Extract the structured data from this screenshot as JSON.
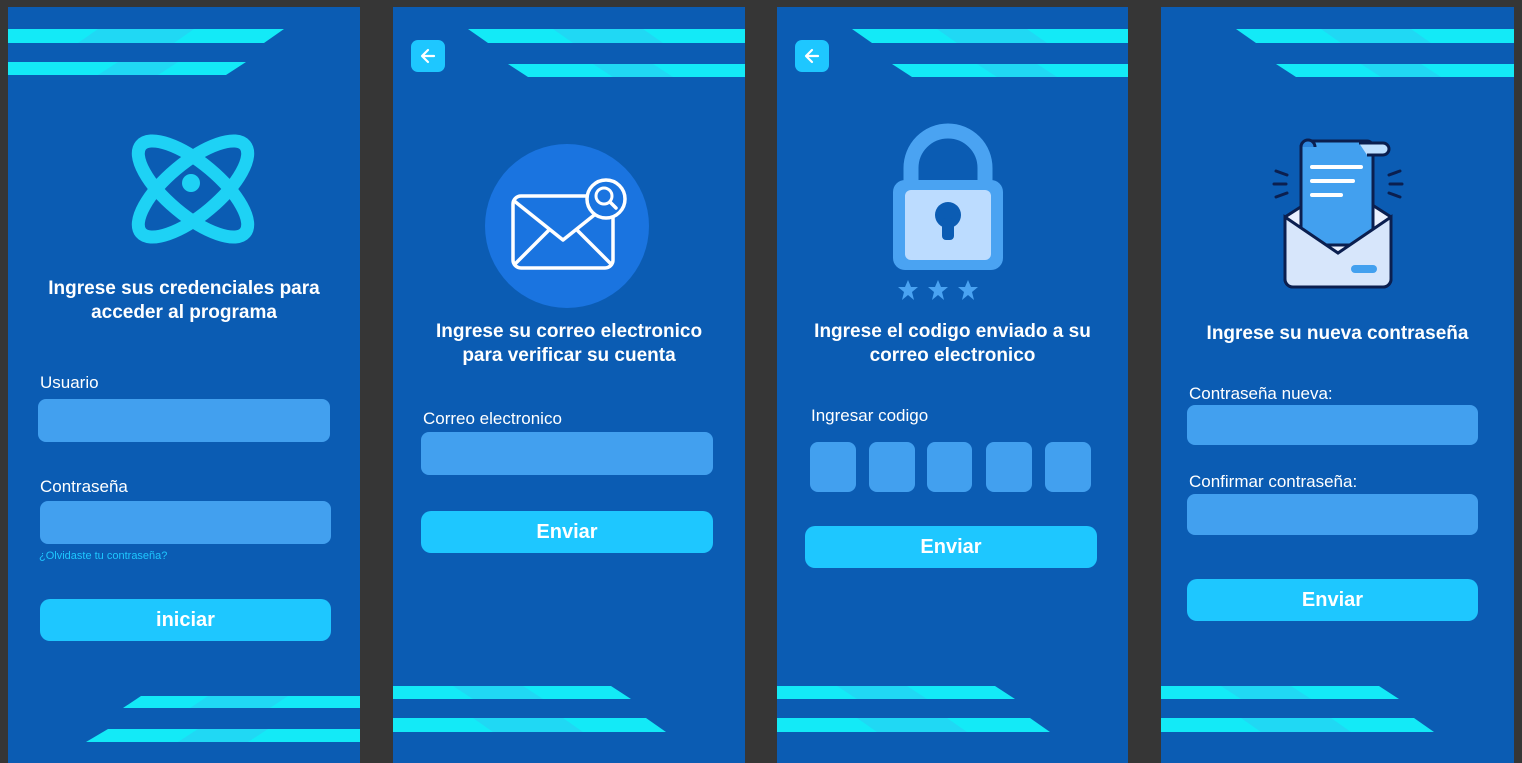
{
  "colors": {
    "background": "#0b5cb3",
    "frame": "#363636",
    "accent": "#1ec7ff",
    "input": "#42a0ef",
    "stripe": "#13eaf7"
  },
  "login": {
    "heading_line1": "Ingrese sus credenciales para",
    "heading_line2": "acceder al programa",
    "user_label": "Usuario",
    "user_value": "",
    "password_label": "Contraseña",
    "password_value": "",
    "forgot_link": "¿Olvidaste tu contraseña?",
    "submit_label": "iniciar"
  },
  "email_verify": {
    "heading_line1": "Ingrese su correo electronico",
    "heading_line2": "para verificar su cuenta",
    "email_label": "Correo electronico",
    "email_value": "",
    "submit_label": "Enviar",
    "icons": [
      "back-arrow-icon",
      "email-search-icon"
    ]
  },
  "code_verify": {
    "heading_line1": "Ingrese el codigo enviado a su",
    "heading_line2": "correo electronico",
    "code_label": "Ingresar codigo",
    "code_digits": [
      "",
      "",
      "",
      "",
      ""
    ],
    "submit_label": "Enviar",
    "icons": [
      "back-arrow-icon",
      "padlock-icon"
    ]
  },
  "new_password": {
    "heading": "Ingrese su nueva contraseña",
    "new_label": "Contraseña nueva:",
    "new_value": "",
    "confirm_label": "Confirmar contraseña:",
    "confirm_value": "",
    "submit_label": "Enviar",
    "icons": [
      "letter-envelope-icon"
    ]
  }
}
